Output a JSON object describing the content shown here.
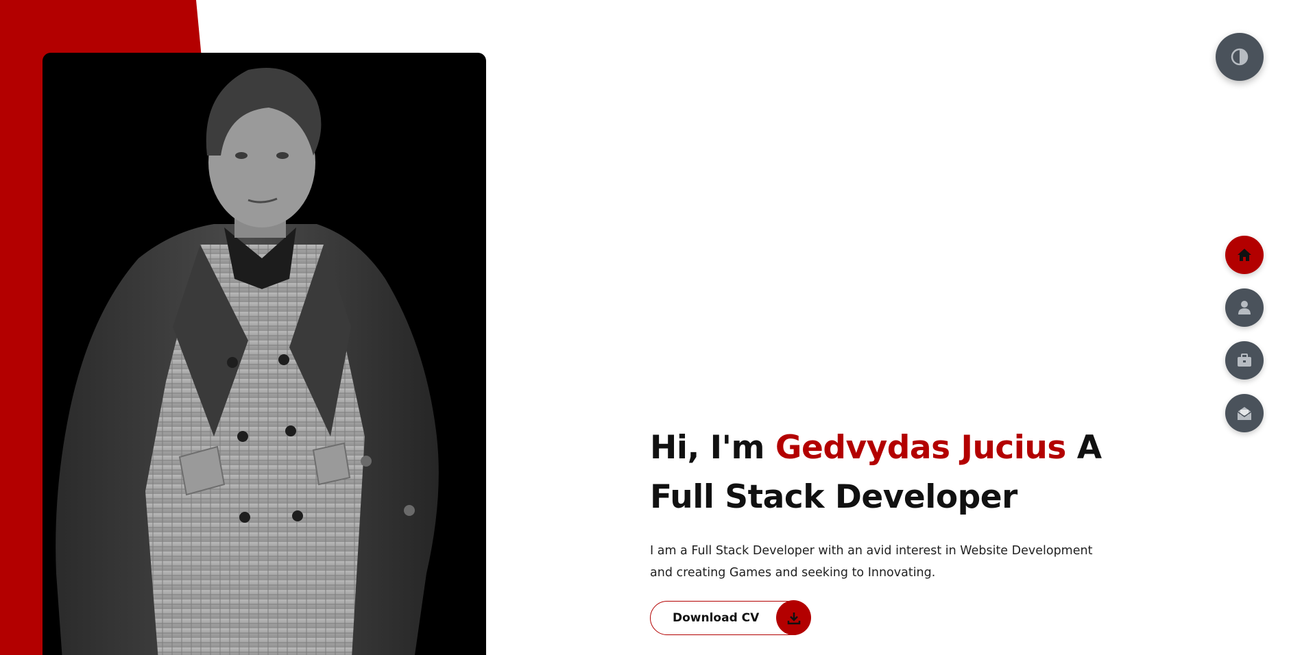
{
  "page": {
    "title": "Gedvydas Jucius Portfolio"
  },
  "colors": {
    "accent": "#b30000",
    "dark_button": "#4a525b",
    "text": "#111111",
    "background": "#ffffff"
  },
  "hero": {
    "greeting": "Hi, I'm ",
    "name": "Gedvydas Jucius",
    "role_line1": " A",
    "role_line2": "Full Stack Developer",
    "intro_line1": "I am a Full Stack Developer with an avid interest in Website Development",
    "intro_line2": "and creating Games and seeking to Innovating."
  },
  "cv_button": {
    "label": "Download CV",
    "icon": "download-icon"
  },
  "theme_toggle": {
    "icon": "contrast-icon"
  },
  "side_nav": {
    "items": [
      {
        "name": "home",
        "icon": "home-icon",
        "active": true
      },
      {
        "name": "about",
        "icon": "user-icon",
        "active": false
      },
      {
        "name": "portfolio",
        "icon": "briefcase-icon",
        "active": false
      },
      {
        "name": "contact",
        "icon": "envelope-open-icon",
        "active": false
      }
    ]
  },
  "photo": {
    "subject": "portrait-photo"
  }
}
